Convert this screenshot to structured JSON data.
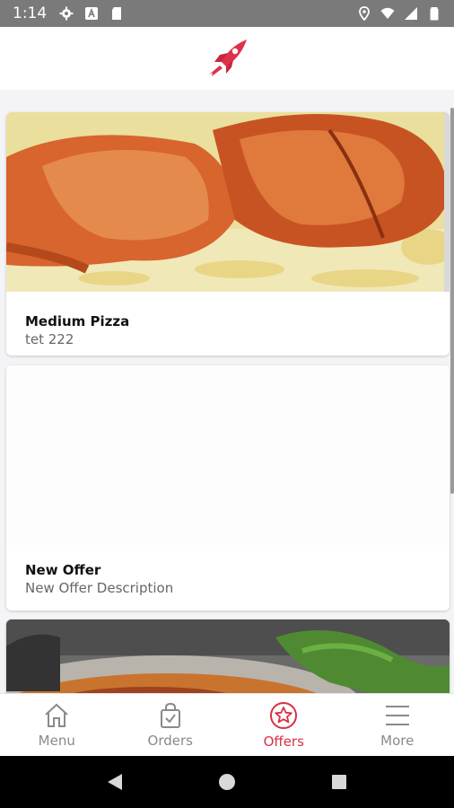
{
  "status_bar": {
    "time": "1:14"
  },
  "offers": [
    {
      "title": "Medium Pizza",
      "description": "tet 222",
      "image": "roast-chicken-rice"
    },
    {
      "title": "New Offer",
      "description": "New Offer Description",
      "image": "blank"
    },
    {
      "title": "",
      "description": "",
      "image": "rice-dish-with-greens"
    }
  ],
  "bottom_nav": {
    "items": [
      {
        "label": "Menu",
        "icon": "home-icon"
      },
      {
        "label": "Orders",
        "icon": "shopping-bag-icon"
      },
      {
        "label": "Offers",
        "icon": "offers-star-icon"
      },
      {
        "label": "More",
        "icon": "hamburger-icon"
      }
    ],
    "active": "Offers"
  },
  "colors": {
    "accent": "#d93045",
    "inactive": "#8a8a8a"
  }
}
